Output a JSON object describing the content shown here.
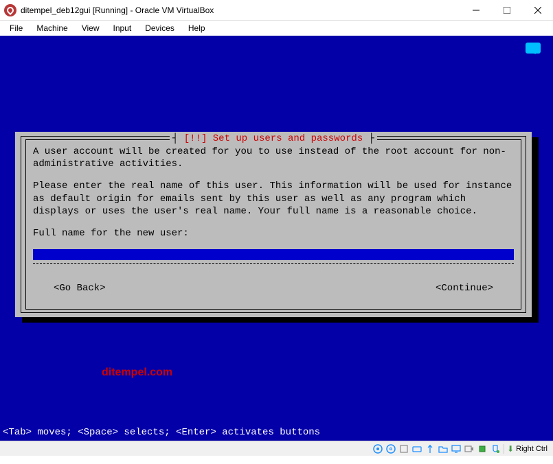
{
  "window": {
    "title": "ditempel_deb12gui [Running] - Oracle VM VirtualBox"
  },
  "menubar": [
    "File",
    "Machine",
    "View",
    "Input",
    "Devices",
    "Help"
  ],
  "installer": {
    "title": "[!!] Set up users and passwords",
    "para1": "A user account will be created for you to use instead of the root account for non-administrative activities.",
    "para2": "Please enter the real name of this user. This information will be used for instance as default origin for emails sent by this user as well as any program which displays or uses the user's real name. Your full name is a reasonable choice.",
    "prompt": "Full name for the new user:",
    "input_value": "",
    "go_back": "<Go Back>",
    "continue": "<Continue>",
    "hint": "<Tab> moves; <Space> selects; <Enter> activates buttons"
  },
  "watermark": "ditempel.com",
  "statusbar": {
    "host_key": "Right Ctrl"
  }
}
